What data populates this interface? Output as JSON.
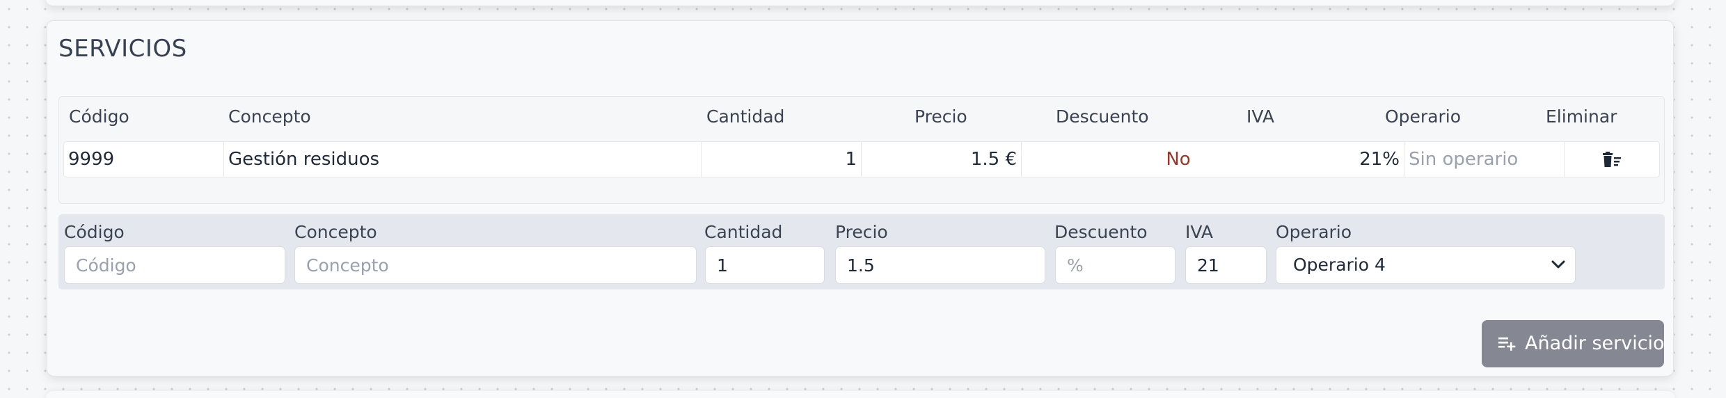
{
  "section": {
    "title": "SERVICIOS"
  },
  "table": {
    "headers": {
      "codigo": "Código",
      "concepto": "Concepto",
      "cantidad": "Cantidad",
      "precio": "Precio",
      "descuento": "Descuento",
      "iva": "IVA",
      "operario": "Operario",
      "eliminar": "Eliminar"
    },
    "rows": [
      {
        "codigo": "9999",
        "concepto": "Gestión residuos",
        "cantidad": "1",
        "precio": "1.5 €",
        "descuento": "No",
        "iva": "21%",
        "operario": "Sin operario",
        "delete_icon": "trash-icon"
      }
    ]
  },
  "form": {
    "codigo": {
      "label": "Código",
      "placeholder": "Código",
      "value": ""
    },
    "concepto": {
      "label": "Concepto",
      "placeholder": "Concepto",
      "value": ""
    },
    "cantidad": {
      "label": "Cantidad",
      "value": "1"
    },
    "precio": {
      "label": "Precio",
      "value": "1.5"
    },
    "descuento": {
      "label": "Descuento",
      "placeholder": "%",
      "value": ""
    },
    "iva": {
      "label": "IVA",
      "value": "21"
    },
    "operario": {
      "label": "Operario",
      "selected": "Operario 4"
    }
  },
  "actions": {
    "add_service_label": "Añadir servicio",
    "add_icon": "playlist-add-icon"
  },
  "colors": {
    "discount_no": "#8f3a2e",
    "button_bg": "#858792",
    "form_band": "#e4e8ee",
    "placeholder": "#9aa1ad"
  }
}
